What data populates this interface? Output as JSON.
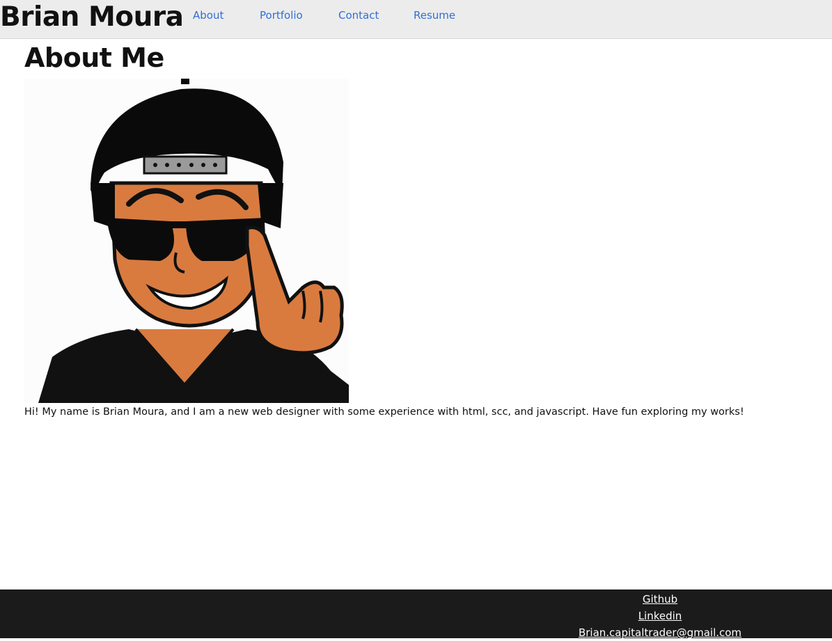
{
  "header": {
    "brand": "Brian Moura",
    "nav": [
      {
        "label": "About"
      },
      {
        "label": "Portfolio"
      },
      {
        "label": "Contact"
      },
      {
        "label": "Resume"
      }
    ]
  },
  "main": {
    "title": "About Me",
    "avatar_icon": "cartoon-avatar",
    "intro": "Hi! My name is Brian Moura, and I am a new web designer with some experience with html, scc, and javascript. Have fun exploring my works!"
  },
  "footer": {
    "links": [
      {
        "label": "Github"
      },
      {
        "label": "Linkedin"
      },
      {
        "label": "Brian.capitaltrader@gmail.com"
      }
    ]
  },
  "colors": {
    "nav_background": "#ececec",
    "link": "#2f6fd6",
    "footer_background": "#1b1b1b"
  }
}
